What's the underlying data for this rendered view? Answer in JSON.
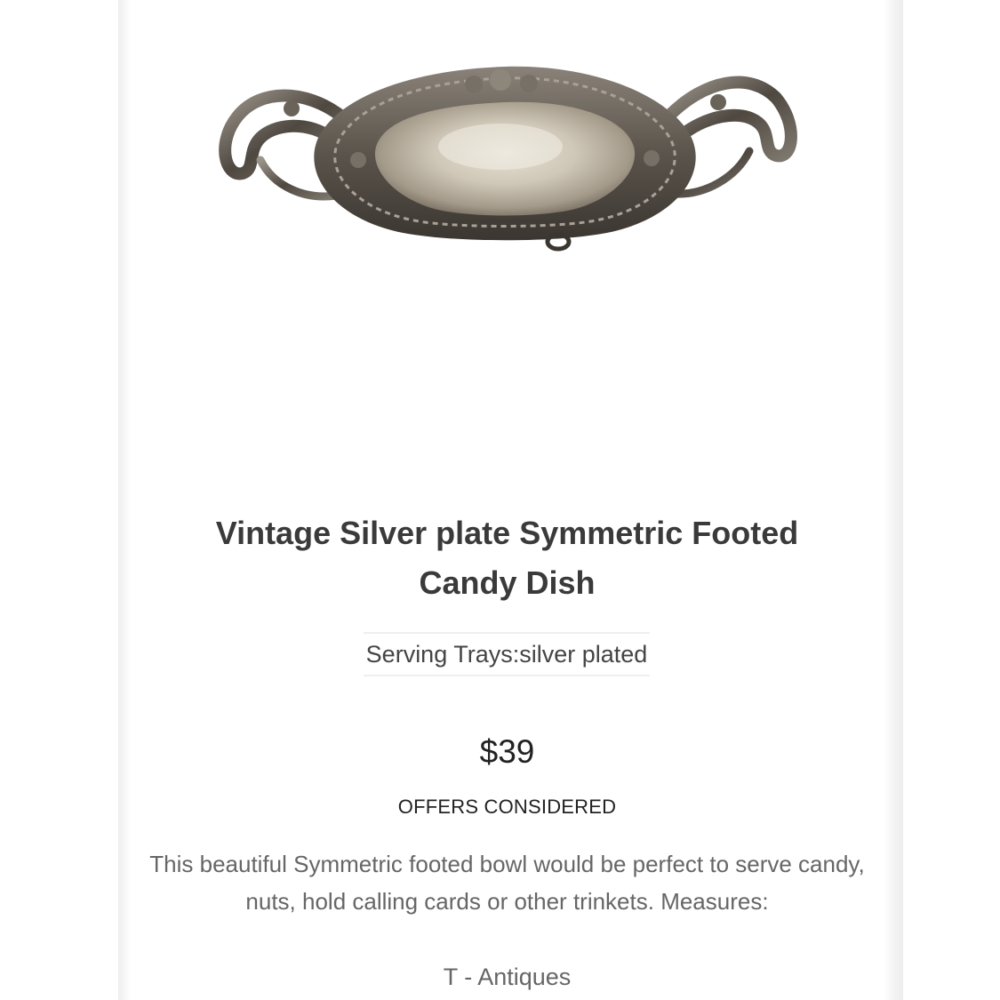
{
  "product": {
    "image_subject": "silver-plated-footed-candy-dish",
    "title": "Vintage Silver plate Symmetric Footed Candy Dish",
    "category": "Serving Trays:silver plated",
    "price": "$39",
    "offers_note": "OFFERS CONSIDERED",
    "description": "This beautiful Symmetric footed bowl would be perfect to serve candy, nuts, hold calling cards or other trinkets. Measures:",
    "seller": "T - Antiques"
  },
  "colors": {
    "page_background": "#ffffff",
    "title_text": "#3a3a3a",
    "body_text": "#666666",
    "price_text": "#222222",
    "divider": "#efefef"
  }
}
